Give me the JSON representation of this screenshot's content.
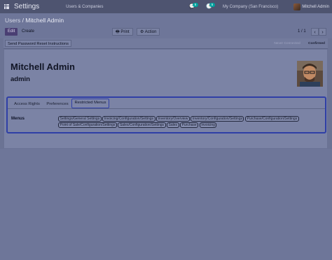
{
  "topbar": {
    "app_title": "Settings",
    "menu_item": "Users & Companies",
    "chat_count": "5",
    "activity_count": "5",
    "company": "My Company (San Francisco)",
    "user_name": "Mitchell Admin"
  },
  "control": {
    "breadcrumb_parent": "Users",
    "breadcrumb_sep": " / ",
    "breadcrumb_current": "Mitchell Admin",
    "edit_label": "Edit",
    "create_label": "Create",
    "print_label": "Print",
    "action_label": "Action",
    "pager_value": "1 / 1"
  },
  "statusbar": {
    "reset_label": "Send Password Reset Instructions",
    "stage_never": "Never Connected",
    "stage_confirmed": "Confirmed"
  },
  "form": {
    "name": "Mitchell Admin",
    "login": "admin"
  },
  "tabs": [
    {
      "label": "Access Rights"
    },
    {
      "label": "Preferences"
    },
    {
      "label": "Restricted Menus",
      "active": true
    }
  ],
  "menus_label": "Menus",
  "menu_tags": [
    "Settings/General Settings",
    "Invoicing/Configuration/Settings",
    "Inventory/Overview",
    "Inventory/Configuration/Settings",
    "Purchase/Configuration/Settings",
    "Point of Sale/Configuration/Settings",
    "Sales/Configuration/Settings",
    "Sales",
    "Purchase",
    "Invoicing"
  ],
  "colors": {
    "overlay_nav": "#4e5470",
    "accent_blue": "#2f3fa6",
    "badge_teal": "#00a09d",
    "primary_button": "#4a3f73"
  }
}
